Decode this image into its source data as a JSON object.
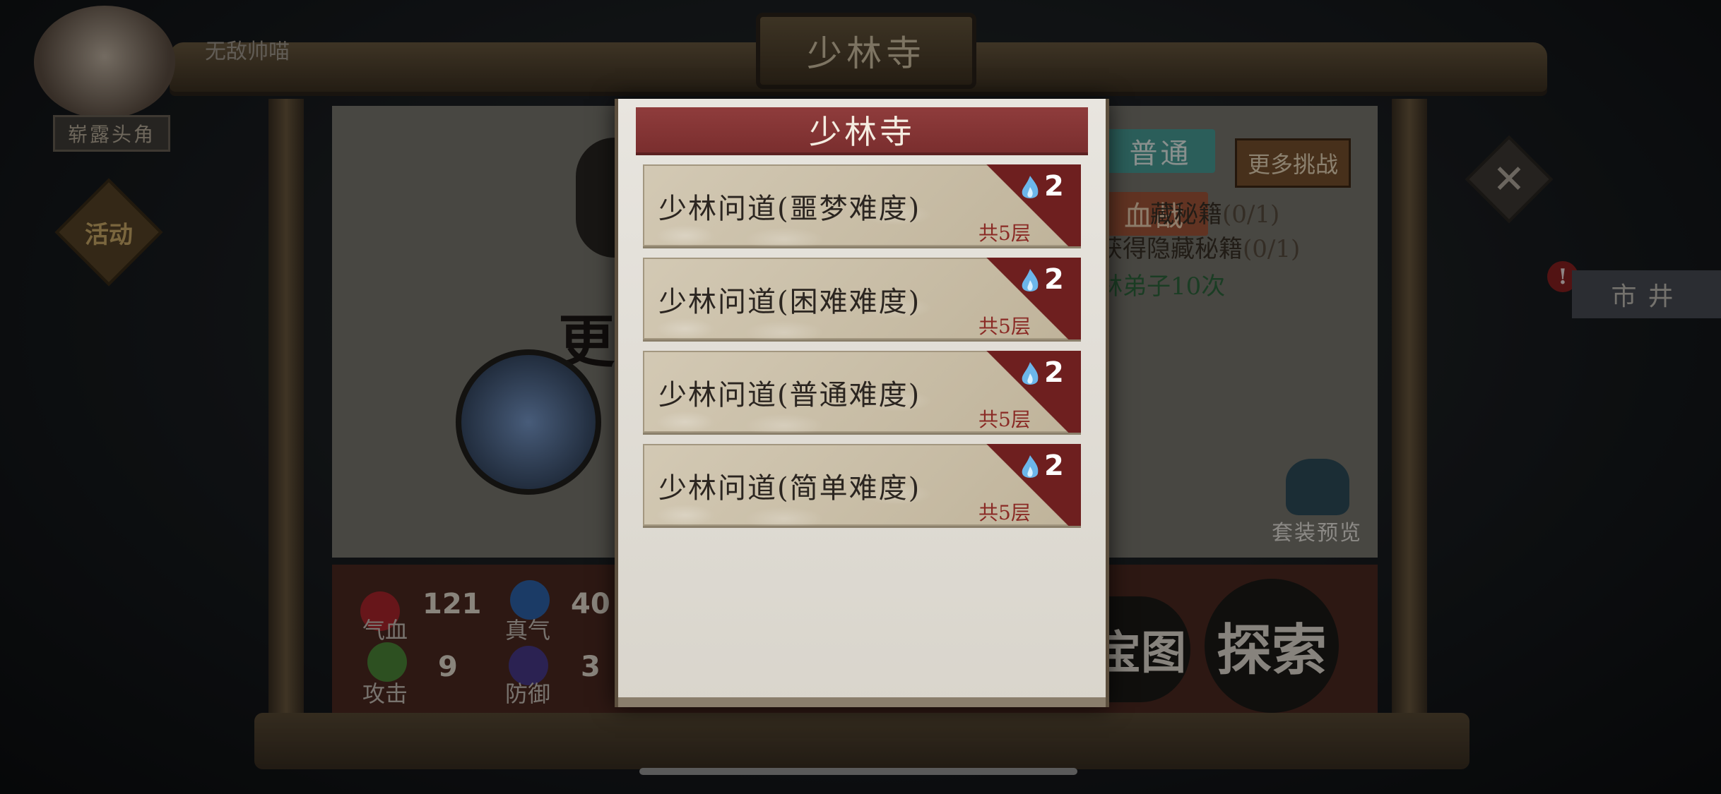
{
  "header": {
    "banner_title": "少林寺",
    "player_name": "无敌帅喵",
    "player_title": "崭露头角",
    "event_tag": "活动"
  },
  "modal": {
    "title": "少林寺",
    "levels": [
      {
        "name": "少林问道(噩梦难度)",
        "floors": "共5层",
        "cost": "2",
        "cost_icon": "blue-flame-icon"
      },
      {
        "name": "少林问道(困难难度)",
        "floors": "共5层",
        "cost": "2",
        "cost_icon": "blue-flame-icon"
      },
      {
        "name": "少林问道(普通难度)",
        "floors": "共5层",
        "cost": "2",
        "cost_icon": "blue-flame-icon"
      },
      {
        "name": "少林问道(简单难度)",
        "floors": "共5层",
        "cost": "2",
        "cost_icon": "blue-flame-icon"
      }
    ]
  },
  "right_panel": {
    "tab_normal": "普通",
    "tab_blood": "血战",
    "more_challenge": "更多挑战",
    "task_1": "藏秘籍",
    "task_1_progress": "(0/1)",
    "task_2": "获得隐藏秘籍",
    "task_2_progress": "(0/1)",
    "task_3": "林弟子10次",
    "set_preview": "套装预览",
    "market": "市井",
    "market_alert": "!",
    "close_glyph": "✕"
  },
  "stats": {
    "hp_label": "气血",
    "hp_value": "121",
    "qi_label": "真气",
    "qi_value": "40",
    "atk_label": "攻击",
    "atk_value": "9",
    "def_label": "防御",
    "def_value": "3"
  },
  "actions": {
    "explore": "探索",
    "treasure": "宝图",
    "update": "更"
  },
  "colors": {
    "modal_header": "#7a2e2e",
    "card_corner": "#6e1f1f",
    "floors_text": "#8a2a25",
    "normal_tab": "#4aa39b",
    "blood_tab": "#a7583c"
  }
}
